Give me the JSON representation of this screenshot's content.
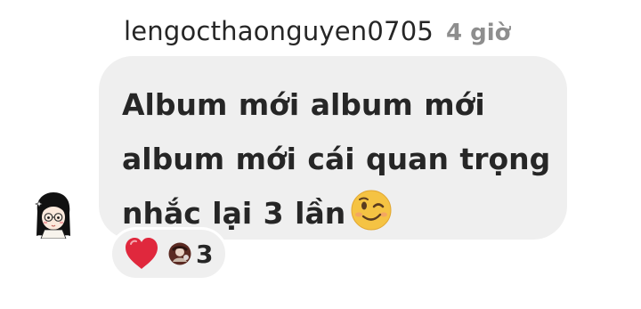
{
  "comment": {
    "username": "lengocthaonguyen0705",
    "time": "4 giờ",
    "text": "Album mới album mới album mới cái quan trọng nhắc lại 3 lần",
    "emoji": "wink-emoji"
  },
  "reactions": {
    "icon": "red-heart-icon",
    "count": "3"
  },
  "colors": {
    "bubble": "#efefef",
    "text": "#262626",
    "muted": "#8e8e8e",
    "heart": "#e0283d",
    "emoji": "#f5c343"
  }
}
